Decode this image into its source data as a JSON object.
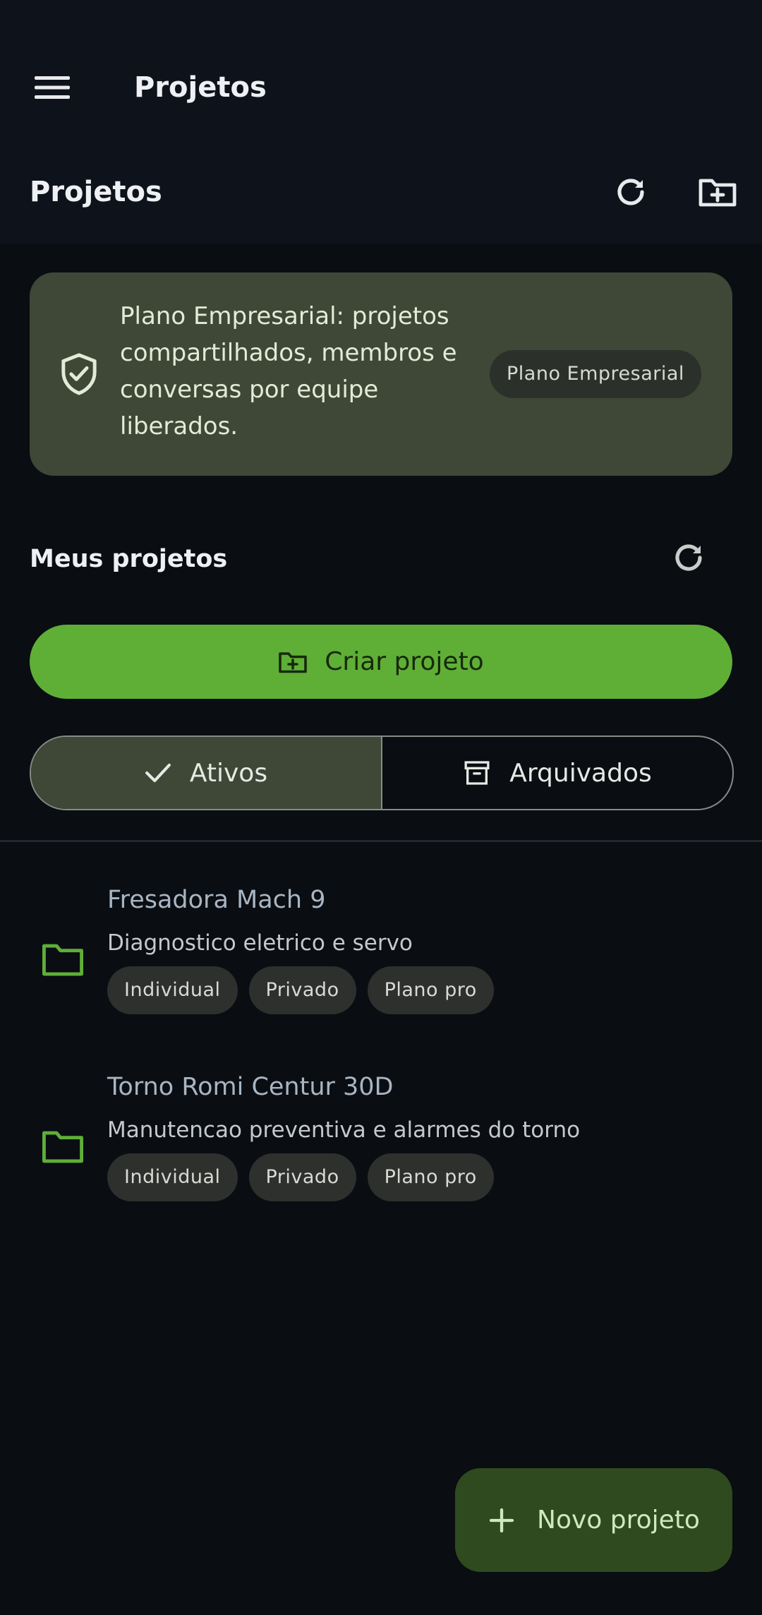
{
  "app_bar": {
    "title": "Projetos",
    "menu_icon": "hamburger-menu-icon"
  },
  "section": {
    "title": "Projetos",
    "refresh_icon": "refresh-icon",
    "new_folder_icon": "folder-plus-icon"
  },
  "banner": {
    "text": "Plano Empresarial: projetos compartilhados, membros e conversas por equipe liberados.",
    "chip": "Plano Empresarial",
    "icon": "shield-check-icon"
  },
  "my_projects": {
    "title": "Meus projetos",
    "refresh_icon": "refresh-icon"
  },
  "create_button": {
    "label": "Criar projeto",
    "icon": "folder-plus-icon"
  },
  "filter": {
    "active_label": "Ativos",
    "archived_label": "Arquivados",
    "selected": "Ativos"
  },
  "projects": [
    {
      "title": "Fresadora Mach 9",
      "description": "Diagnostico eletrico e servo",
      "tags": [
        "Individual",
        "Privado",
        "Plano pro"
      ]
    },
    {
      "title": "Torno Romi Centur 30D",
      "description": "Manutencao preventiva e alarmes do torno",
      "tags": [
        "Individual",
        "Privado",
        "Plano pro"
      ]
    }
  ],
  "fab": {
    "label": "Novo projeto",
    "icon": "plus-icon"
  },
  "colors": {
    "background": "#0a0d12",
    "appbar": "#0e131b",
    "accent_green": "#5faf37",
    "banner": "#3f4737",
    "fab": "#2f4a1f"
  }
}
